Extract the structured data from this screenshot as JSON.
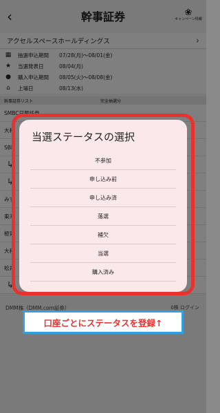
{
  "header": {
    "back_icon": "chevron-left-icon",
    "title": "幹事証券",
    "campaign_label": "キャンペーン情報"
  },
  "company": {
    "name": "アクセルスペースホールディングス"
  },
  "info": [
    {
      "icon": "calendar-icon",
      "label": "抽選申込期間",
      "value": "07/28(月)〜08/01(金)"
    },
    {
      "icon": "star-icon",
      "label": "当選発表日",
      "value": "08/04(月)"
    },
    {
      "icon": "hand-coin-icon",
      "label": "購入申込期間",
      "value": "08/05(火)〜08/08(金)"
    },
    {
      "icon": "bank-icon",
      "label": "上場日",
      "value": "08/13(水)"
    }
  ],
  "list_header": {
    "col1": "幹事証券リスト",
    "col2": "完全抽選分"
  },
  "rows": [
    "SMBC日興証券",
    "大和",
    "SBI",
    "↳",
    "↳",
    "みず",
    "東海",
    "極東",
    "大和",
    "松井",
    "↳"
  ],
  "dmm": {
    "name": "DMM株（DMM.com証券）",
    "right": "0株  ログイン"
  },
  "modal": {
    "title": "当選ステータスの選択",
    "options": [
      "不参加",
      "申し込み前",
      "申し込み済",
      "落選",
      "補欠",
      "当選",
      "購入済み"
    ]
  },
  "banner": {
    "text": "口座ごとにステータスを登録↑"
  },
  "colors": {
    "highlight": "#e8322d",
    "banner_border": "#33a1e0",
    "modal_bg": "#fbe8e8"
  }
}
